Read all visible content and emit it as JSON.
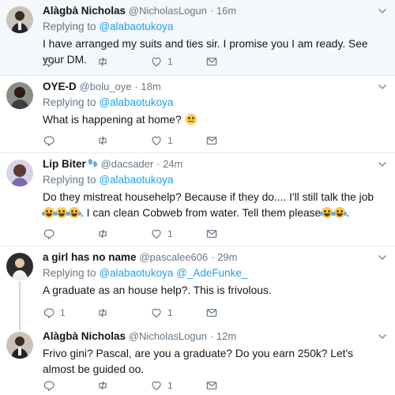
{
  "colors": {
    "accent": "#1da1f2",
    "muted": "#657786",
    "text": "#14171a",
    "border": "#e6ecf0",
    "highlight": "#f5f8fa"
  },
  "tweets": [
    {
      "name": "Alàgbà Nicholas",
      "handle": "@NicholasLogun",
      "dot": "·",
      "time": "16m",
      "replying_prefix": "Replying to",
      "replying_to": "@alabaotukoya",
      "text": "I have arranged my suits and ties sir. I promise you I am ready. See your DM.",
      "like_count": "1"
    },
    {
      "name": "OYE-D",
      "handle": "@bolu_oye",
      "dot": "·",
      "time": "18m",
      "replying_prefix": "Replying to",
      "replying_to": "@alabaotukoya",
      "text": "What is happening at home?",
      "like_count": "1"
    },
    {
      "name": "Lip Biter",
      "handle": "@dacsader",
      "dot": "·",
      "time": "24m",
      "replying_prefix": "Replying to",
      "replying_to": "@alabaotukoya",
      "text_part1": "Do they mistreat househelp? Because if they do.... I'll still talk the job",
      "text_part2": ". I can clean Cobweb from water. Tell them please",
      "like_count": "1"
    },
    {
      "name": "a girl has no name",
      "handle": "@pascalee606",
      "dot": "·",
      "time": "29m",
      "replying_prefix": "Replying to",
      "replying_to": "@alabaotukoya",
      "replying_to_2": "@_AdeFunke_",
      "text": "A graduate as an house help?. This is frivolous.",
      "reply_count": "1",
      "like_count": "1"
    },
    {
      "name": "Alàgbà Nicholas",
      "handle": "@NicholasLogun",
      "dot": "·",
      "time": "12m",
      "text": "Frivo gini? Pascal, are you a graduate? Do you earn 250k? Let's almost be guided oo.",
      "like_count": "1"
    }
  ]
}
